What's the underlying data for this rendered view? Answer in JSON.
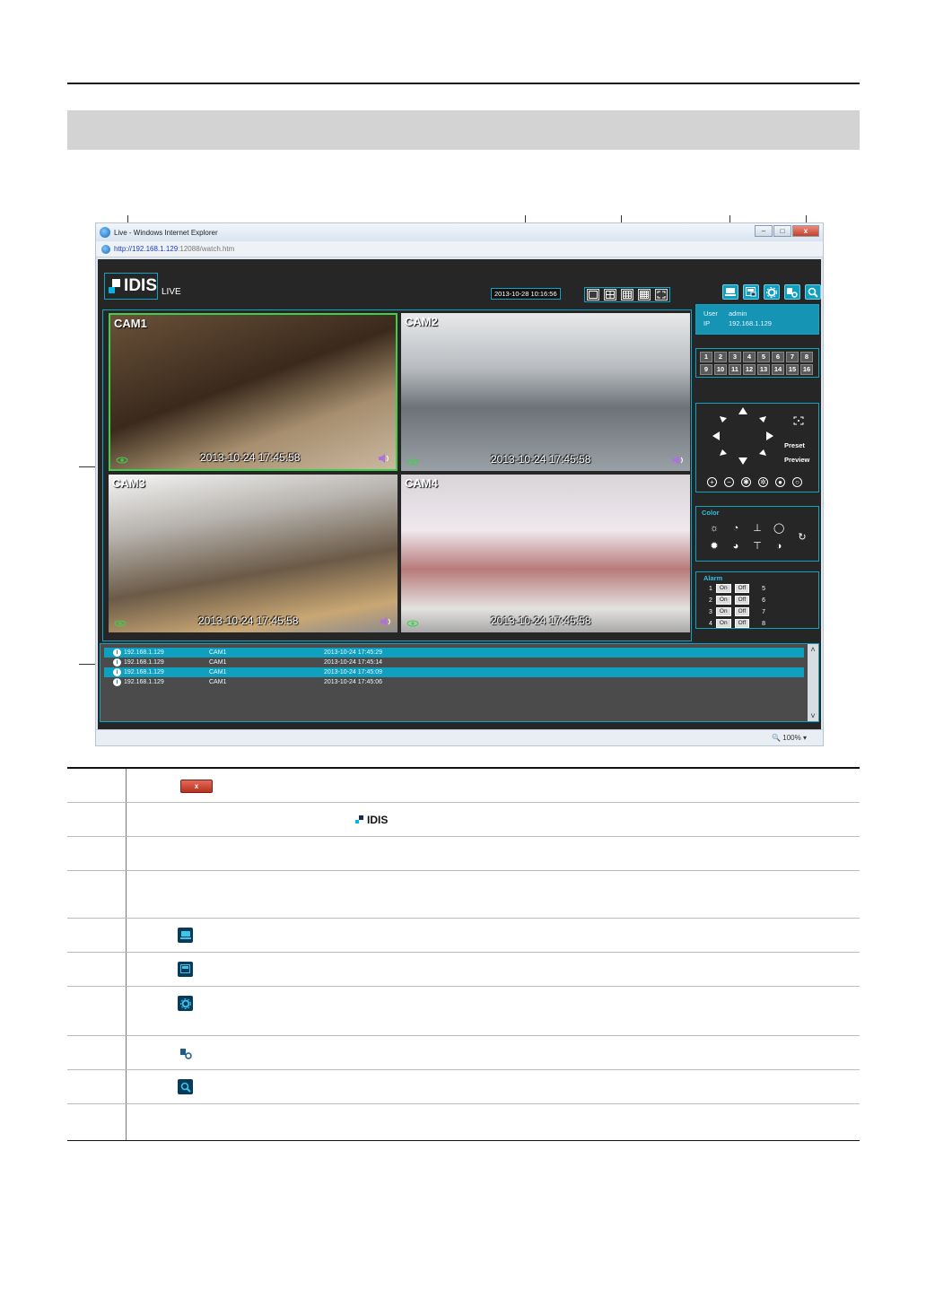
{
  "browser": {
    "title": "Live - Windows Internet Explorer",
    "address_ip": "http://192.168.1.129",
    "address_rest": ":12088/watch.htm",
    "window_close": "x",
    "zoom": "100%"
  },
  "app": {
    "logo_text": "IDIS",
    "live_label": "LIVE",
    "datetime": "2013-10-28 10:16:56"
  },
  "cameras": [
    {
      "label": "CAM1",
      "timestamp": "2013-10-24 17:45:58"
    },
    {
      "label": "CAM2",
      "timestamp": "2013-10-24 17:45:58"
    },
    {
      "label": "CAM3",
      "timestamp": "2013-10-24 17:45:58"
    },
    {
      "label": "CAM4",
      "timestamp": "2013-10-24 17:45:58"
    }
  ],
  "user_info": {
    "user_key": "User",
    "user_val": "admin",
    "ip_key": "IP",
    "ip_val": "192.168.1.129"
  },
  "channels": [
    "1",
    "2",
    "3",
    "4",
    "5",
    "6",
    "7",
    "8",
    "9",
    "10",
    "11",
    "12",
    "13",
    "14",
    "15",
    "16"
  ],
  "ptz": {
    "preset": "Preset",
    "preview": "Preview"
  },
  "color": {
    "title": "Color"
  },
  "alarm": {
    "title": "Alarm",
    "on": "On",
    "off": "Off",
    "rows": [
      {
        "left": "1",
        "right": "5"
      },
      {
        "left": "2",
        "right": "6"
      },
      {
        "left": "3",
        "right": "7"
      },
      {
        "left": "4",
        "right": "8"
      }
    ]
  },
  "events": [
    {
      "ip": "192.168.1.129",
      "cam": "CAM1",
      "time": "2013-10-24 17:45:29",
      "highlight": true
    },
    {
      "ip": "192.168.1.129",
      "cam": "CAM1",
      "time": "2013-10-24 17:45:14",
      "highlight": false
    },
    {
      "ip": "192.168.1.129",
      "cam": "CAM1",
      "time": "2013-10-24 17:45:09",
      "highlight": true
    },
    {
      "ip": "192.168.1.129",
      "cam": "CAM1",
      "time": "2013-10-24 17:45:06",
      "highlight": false
    }
  ],
  "table": {
    "close_icon_label": "x",
    "idis_icon_label": "IDIS"
  },
  "colors": {
    "accent": "#0fa3c4",
    "selected_border": "#3fcf4d",
    "close_red": "#c4412b"
  }
}
